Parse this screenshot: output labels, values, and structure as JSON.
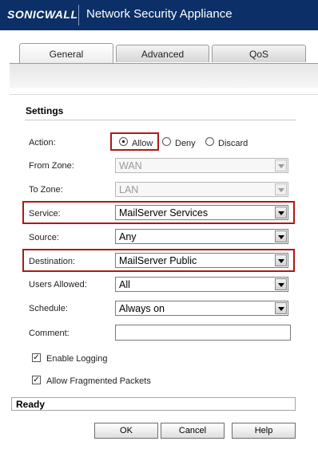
{
  "header": {
    "brand": "SONICWALL",
    "title": "Network Security Appliance"
  },
  "tabs": [
    {
      "label": "General",
      "active": true
    },
    {
      "label": "Advanced",
      "active": false
    },
    {
      "label": "QoS",
      "active": false
    }
  ],
  "settings": {
    "title": "Settings",
    "action": {
      "label": "Action:",
      "options": [
        "Allow",
        "Deny",
        "Discard"
      ],
      "selected": "Allow"
    },
    "from_zone": {
      "label": "From Zone:",
      "value": "WAN",
      "disabled": true
    },
    "to_zone": {
      "label": "To Zone:",
      "value": "LAN",
      "disabled": true
    },
    "service": {
      "label": "Service:",
      "value": "MailServer Services"
    },
    "source": {
      "label": "Source:",
      "value": "Any"
    },
    "destination": {
      "label": "Destination:",
      "value": "MailServer Public"
    },
    "users_allowed": {
      "label": "Users Allowed:",
      "value": "All"
    },
    "schedule": {
      "label": "Schedule:",
      "value": "Always on"
    },
    "comment": {
      "label": "Comment:",
      "value": ""
    },
    "enable_logging": {
      "label": "Enable Logging",
      "checked": true
    },
    "allow_fragmented": {
      "label": "Allow Fragmented Packets",
      "checked": true
    }
  },
  "status": {
    "text": "Ready"
  },
  "buttons": {
    "ok": "OK",
    "cancel": "Cancel",
    "help": "Help"
  },
  "colors": {
    "header_bg": "#0b2f66",
    "highlight": "#b01818"
  }
}
